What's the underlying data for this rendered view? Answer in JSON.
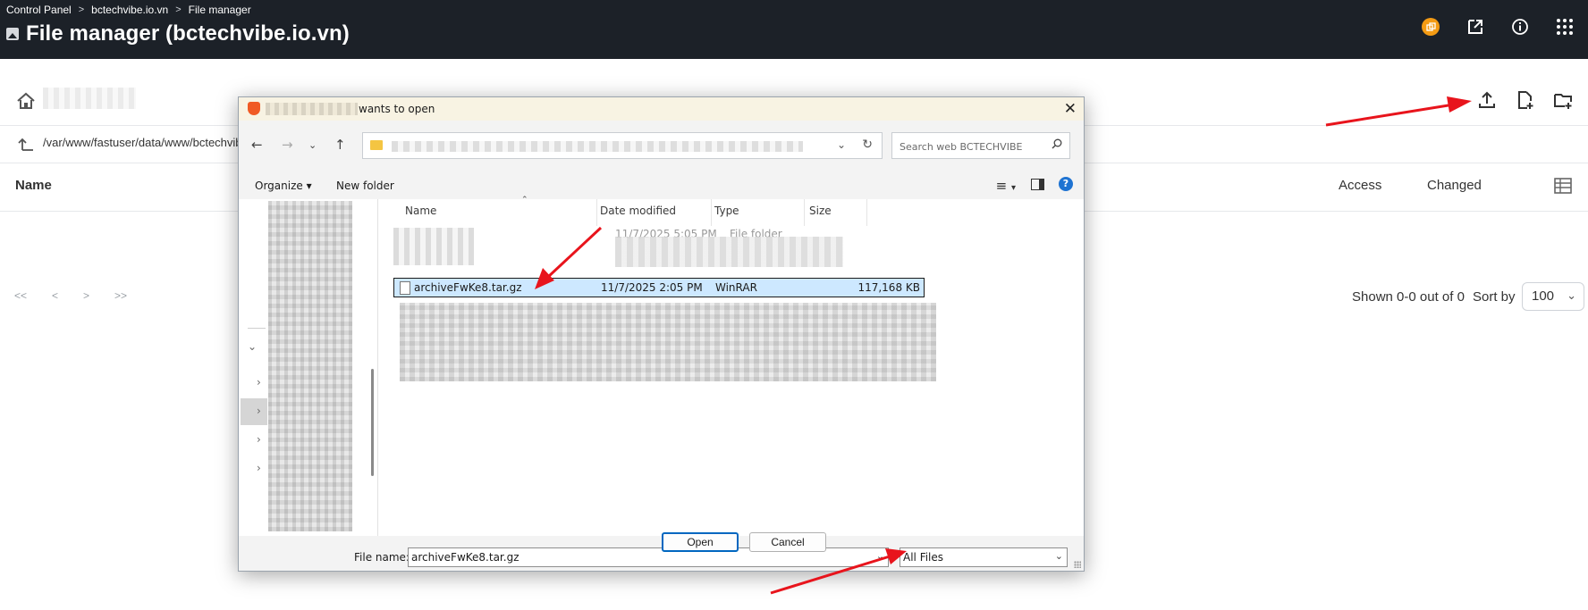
{
  "header": {
    "breadcrumbs": [
      "Control Panel",
      "bctechvibe.io.vn",
      "File manager"
    ],
    "title": "File manager (bctechvibe.io.vn)"
  },
  "page": {
    "path": "/var/www/fastuser/data/www/bctechvib",
    "columns": {
      "name": "Name",
      "access": "Access",
      "changed": "Changed"
    },
    "pager": [
      "<<",
      "<",
      ">",
      ">>"
    ],
    "shown": "Shown 0-0 out of 0",
    "sort_by_label": "Sort by",
    "sort_by_value": "100"
  },
  "dialog": {
    "title_suffix": "wants to open",
    "search_placeholder": "Search web BCTECHVIBE",
    "organize": "Organize",
    "new_folder": "New folder",
    "columns": {
      "name": "Name",
      "date": "Date modified",
      "type": "Type",
      "size": "Size"
    },
    "folder_row": {
      "date": "11/7/2025 5:05 PM",
      "type": "File folder"
    },
    "selected_file": {
      "name": "archiveFwKe8.tar.gz",
      "date": "11/7/2025 2:05 PM",
      "type": "WinRAR",
      "size": "117,168 KB"
    },
    "file_name_label": "File name:",
    "file_name_value": "archiveFwKe8.tar.gz",
    "filter": "All Files",
    "open": "Open",
    "cancel": "Cancel"
  },
  "colors": {
    "header_bg": "#1c2128",
    "annotation_arrow": "#e8141c",
    "selection": "#cde8ff",
    "primary_button_border": "#0067c0"
  }
}
